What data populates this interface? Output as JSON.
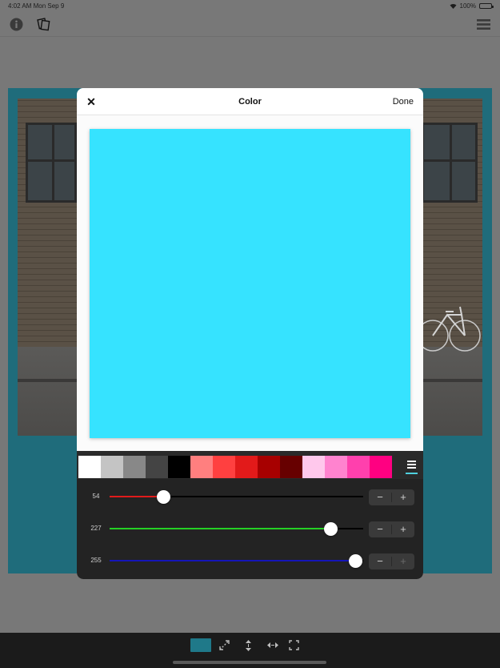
{
  "status_bar": {
    "time": "4:02 AM  Mon Sep 9",
    "battery": "100%"
  },
  "toolbar": {
    "left_icons": [
      "info-icon",
      "cards-icon"
    ],
    "right_icon": "hamburger-menu-icon"
  },
  "modal": {
    "close_label": "✕",
    "title": "Color",
    "done_label": "Done",
    "preview_color": "#36e3ff"
  },
  "palette": {
    "swatches": [
      "#ffffff",
      "#c4c4c4",
      "#888888",
      "#444444",
      "#000000",
      "#ff7f7f",
      "#ff4040",
      "#e21a1a",
      "#a70000",
      "#670000",
      "#ffc8ec",
      "#ff83cf",
      "#ff40ad",
      "#ff0081"
    ],
    "menu_icon": "list-icon",
    "accent_color": "#4fd0de"
  },
  "sliders": [
    {
      "channel": "red",
      "value": "54",
      "level": 0.21,
      "color": "#e01b1b",
      "minus": "−",
      "plus": "+"
    },
    {
      "channel": "green",
      "value": "227",
      "level": 0.87,
      "color": "#25d125",
      "minus": "−",
      "plus": "+"
    },
    {
      "channel": "blue",
      "value": "255",
      "level": 0.97,
      "color": "#1515b8",
      "minus": "−",
      "plus": "+"
    }
  ],
  "bottom_bar": {
    "current_color": "#1f7989",
    "icons": [
      "resize-diagonal-icon",
      "resize-vertical-icon",
      "resize-horizontal-icon",
      "fullscreen-icon"
    ]
  }
}
